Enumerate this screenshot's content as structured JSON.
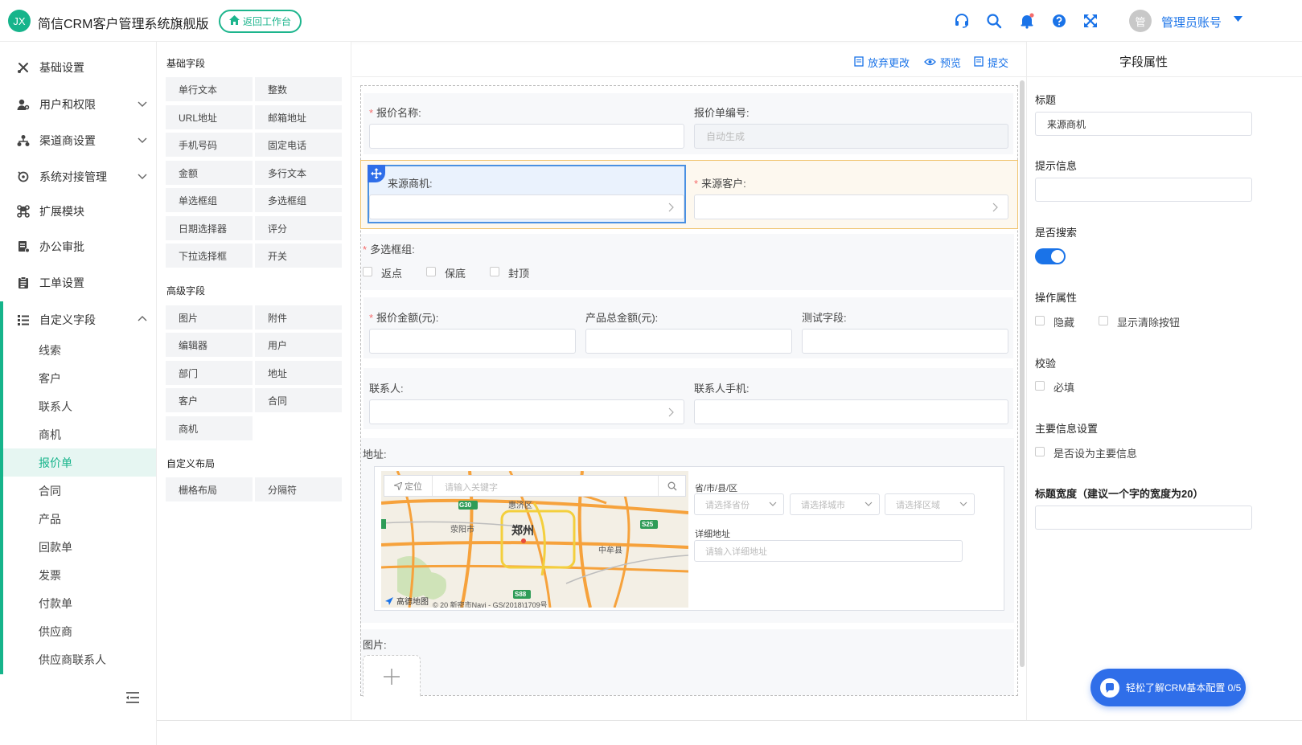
{
  "header": {
    "logo_text": "JX",
    "app_title": "简信CRM客户管理系统旗舰版",
    "back_button": "返回工作台",
    "avatar_text": "管",
    "user_name": "管理员账号"
  },
  "sidebar": {
    "items": [
      {
        "label": "基础设置",
        "icon": "tools-icon"
      },
      {
        "label": "用户和权限",
        "icon": "user-key-icon"
      },
      {
        "label": "渠道商设置",
        "icon": "network-icon"
      },
      {
        "label": "系统对接管理",
        "icon": "link-icon"
      },
      {
        "label": "扩展模块",
        "icon": "command-icon"
      },
      {
        "label": "办公审批",
        "icon": "approval-icon"
      },
      {
        "label": "工单设置",
        "icon": "clipboard-icon"
      },
      {
        "label": "自定义字段",
        "icon": "list-icon"
      }
    ],
    "sub_items": [
      "线索",
      "客户",
      "联系人",
      "商机",
      "报价单",
      "合同",
      "产品",
      "回款单",
      "发票",
      "付款单",
      "供应商",
      "供应商联系人"
    ],
    "active_sub": "报价单"
  },
  "palette": {
    "basic_title": "基础字段",
    "basic_fields": [
      "单行文本",
      "整数",
      "URL地址",
      "邮箱地址",
      "手机号码",
      "固定电话",
      "金额",
      "多行文本",
      "单选框组",
      "多选框组",
      "日期选择器",
      "评分",
      "下拉选择框",
      "开关"
    ],
    "advanced_title": "高级字段",
    "advanced_fields": [
      "图片",
      "附件",
      "编辑器",
      "用户",
      "部门",
      "地址",
      "客户",
      "合同",
      "商机"
    ],
    "layout_title": "自定义布局",
    "layout_fields": [
      "栅格布局",
      "分隔符"
    ]
  },
  "toolbar": {
    "discard": "放弃更改",
    "preview": "预览",
    "submit": "提交"
  },
  "form": {
    "quote_name": "报价名称:",
    "quote_no": "报价单编号:",
    "quote_no_placeholder": "自动生成",
    "source_opportunity": "来源商机:",
    "source_customer": "来源客户:",
    "multi_checkbox": "多选框组:",
    "checkbox_options": [
      "返点",
      "保底",
      "封顶"
    ],
    "quote_amount": "报价金额(元):",
    "product_total": "产品总金额(元):",
    "test_field": "测试字段:",
    "contact": "联系人:",
    "contact_phone": "联系人手机:",
    "address": "地址:",
    "map_locate": "定位",
    "map_search_placeholder": "请输入关键字",
    "region_label": "省/市/县/区",
    "province_placeholder": "请选择省份",
    "city_placeholder": "请选择城市",
    "district_placeholder": "请选择区域",
    "detail_label": "详细地址",
    "detail_placeholder": "请输入详细地址",
    "map_labels": {
      "city": "郑州",
      "xingyang": "荥阳市",
      "huiji": "惠济区",
      "zhongmou": "中牟县",
      "xinmi": "新密市",
      "g30": "G30",
      "s25": "S25",
      "s88": "S88",
      "watermark": "高德地图",
      "copyright": "© 20 新密市Navi - GS(2018)1709号"
    },
    "image": "图片:"
  },
  "props": {
    "title": "字段属性",
    "label_title": "标题",
    "title_value": "来源商机",
    "label_hint": "提示信息",
    "label_search": "是否搜索",
    "search_on": true,
    "label_ops": "操作属性",
    "hide": "隐藏",
    "show_clear": "显示清除按钮",
    "label_validate": "校验",
    "required": "必填",
    "label_main": "主要信息设置",
    "set_main": "是否设为主要信息",
    "label_width": "标题宽度（建议一个字的宽度为20）"
  },
  "helper": {
    "text": "轻松了解CRM基本配置 0/5"
  },
  "colors": {
    "brand": "#16b48b",
    "accent": "#1a73e8",
    "helper": "#2f6ee9",
    "selected_border": "#4a90e2",
    "hover_border": "#f0c36d"
  }
}
